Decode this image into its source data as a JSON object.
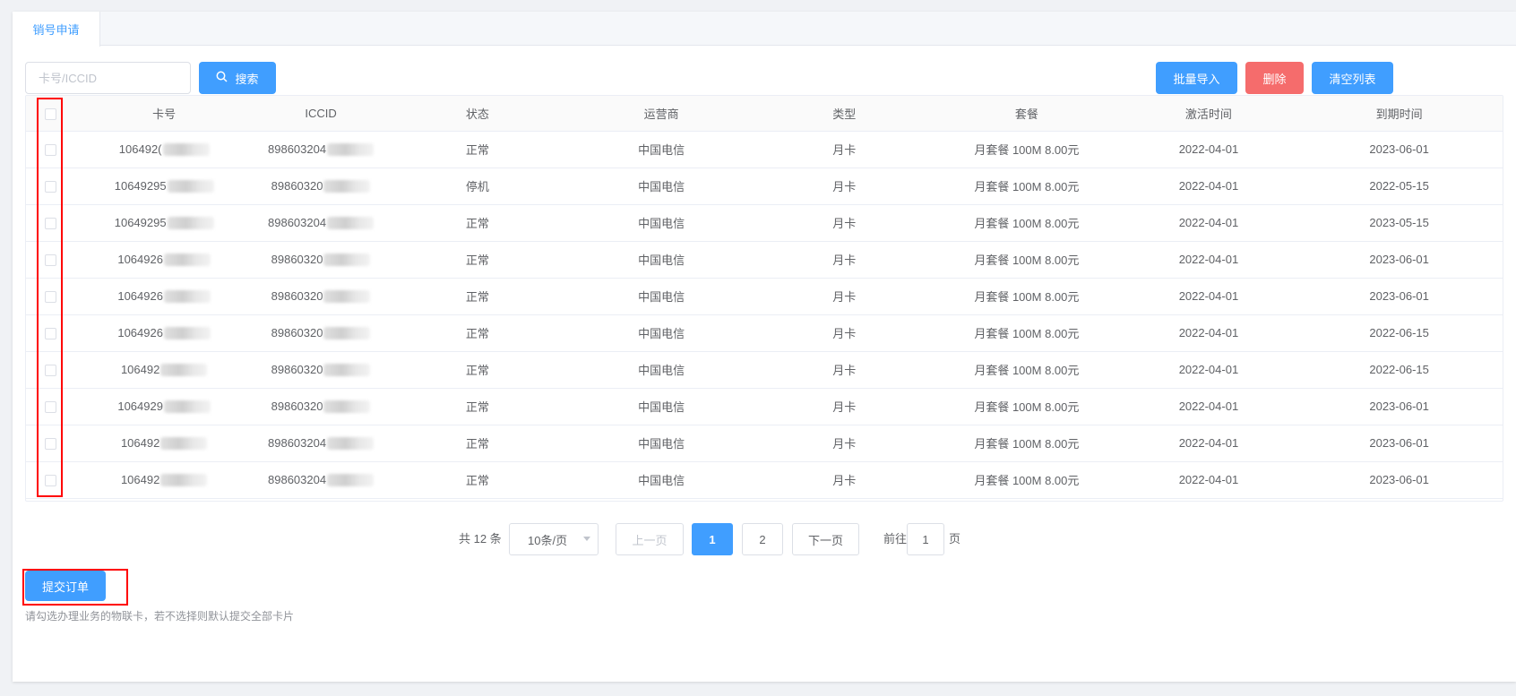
{
  "tabs": [
    {
      "label": "销号申请"
    }
  ],
  "toolbar": {
    "search_placeholder": "卡号/ICCID",
    "search_label": "搜索",
    "import_label": "批量导入",
    "delete_label": "删除",
    "clear_label": "清空列表"
  },
  "colors": {
    "primary": "#409eff",
    "danger": "#f56c6c",
    "annotation": "#ff0000"
  },
  "table": {
    "columns": [
      "卡号",
      "ICCID",
      "状态",
      "运营商",
      "类型",
      "套餐",
      "激活时间",
      "到期时间"
    ],
    "rows": [
      {
        "card": "106492(",
        "iccid": "898603204",
        "status": "正常",
        "carrier": "中国电信",
        "type": "月卡",
        "plan": "月套餐 100M 8.00元",
        "activated": "2022-04-01",
        "expires": "2023-06-01"
      },
      {
        "card": "10649295",
        "iccid": "89860320",
        "status": "停机",
        "carrier": "中国电信",
        "type": "月卡",
        "plan": "月套餐 100M 8.00元",
        "activated": "2022-04-01",
        "expires": "2022-05-15"
      },
      {
        "card": "10649295",
        "iccid": "898603204",
        "status": "正常",
        "carrier": "中国电信",
        "type": "月卡",
        "plan": "月套餐 100M 8.00元",
        "activated": "2022-04-01",
        "expires": "2023-05-15"
      },
      {
        "card": "1064926",
        "iccid": "89860320",
        "status": "正常",
        "carrier": "中国电信",
        "type": "月卡",
        "plan": "月套餐 100M 8.00元",
        "activated": "2022-04-01",
        "expires": "2023-06-01"
      },
      {
        "card": "1064926",
        "iccid": "89860320",
        "status": "正常",
        "carrier": "中国电信",
        "type": "月卡",
        "plan": "月套餐 100M 8.00元",
        "activated": "2022-04-01",
        "expires": "2023-06-01"
      },
      {
        "card": "1064926",
        "iccid": "89860320",
        "status": "正常",
        "carrier": "中国电信",
        "type": "月卡",
        "plan": "月套餐 100M 8.00元",
        "activated": "2022-04-01",
        "expires": "2022-06-15"
      },
      {
        "card": "106492",
        "iccid": "89860320",
        "status": "正常",
        "carrier": "中国电信",
        "type": "月卡",
        "plan": "月套餐 100M 8.00元",
        "activated": "2022-04-01",
        "expires": "2022-06-15"
      },
      {
        "card": "1064929",
        "iccid": "89860320",
        "status": "正常",
        "carrier": "中国电信",
        "type": "月卡",
        "plan": "月套餐 100M 8.00元",
        "activated": "2022-04-01",
        "expires": "2023-06-01"
      },
      {
        "card": "106492",
        "iccid": "898603204",
        "status": "正常",
        "carrier": "中国电信",
        "type": "月卡",
        "plan": "月套餐 100M 8.00元",
        "activated": "2022-04-01",
        "expires": "2023-06-01"
      },
      {
        "card": "106492",
        "iccid": "898603204",
        "status": "正常",
        "carrier": "中国电信",
        "type": "月卡",
        "plan": "月套餐 100M 8.00元",
        "activated": "2022-04-01",
        "expires": "2023-06-01"
      }
    ]
  },
  "pagination": {
    "total_text": "共 12 条",
    "page_size": "10条/页",
    "prev": "上一页",
    "pages": [
      "1",
      "2"
    ],
    "current": "1",
    "next": "下一页",
    "goto_label": "前往",
    "goto_value": "1",
    "page_suffix": "页"
  },
  "footer": {
    "submit_label": "提交订单",
    "hint": "请勾选办理业务的物联卡，若不选择则默认提交全部卡片"
  }
}
